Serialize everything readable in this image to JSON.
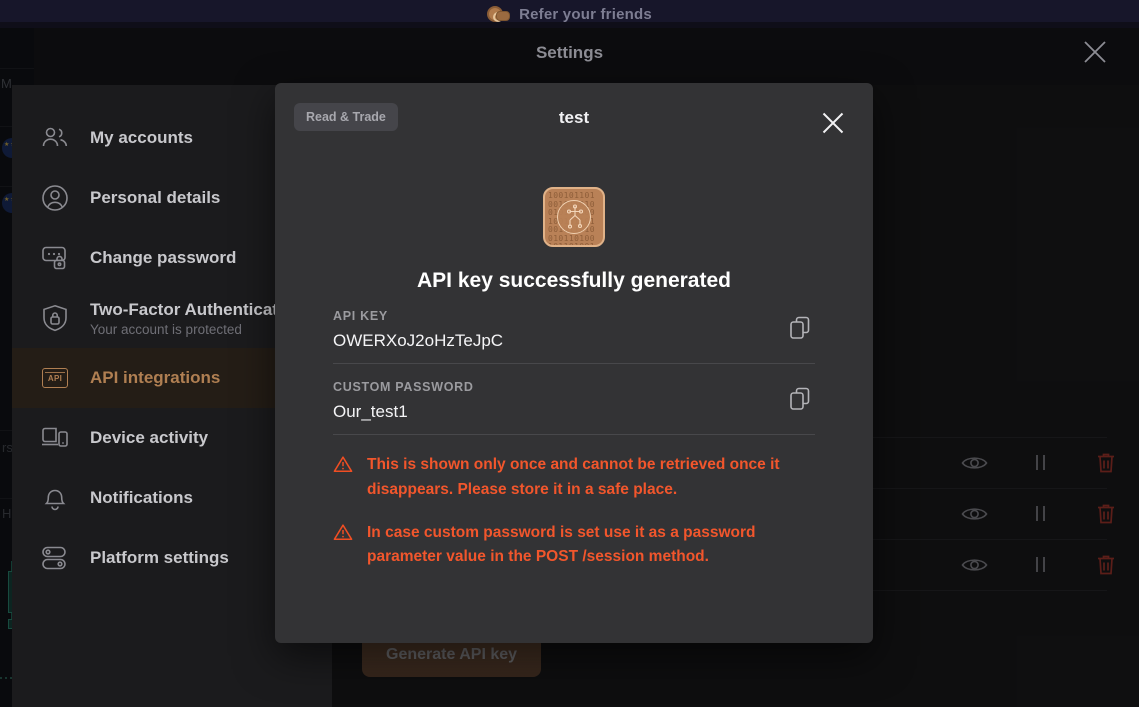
{
  "app": {
    "promo_banner": {
      "text": "Refer your friends",
      "coin_icon": "coins-icon"
    },
    "chart_strip": {
      "top_label": "M",
      "mid_label": "rs",
      "low_label": "H"
    }
  },
  "settings": {
    "title": "Settings",
    "close_icon": "close-icon",
    "sidebar": {
      "items": [
        {
          "label": "My accounts",
          "icon": "people-icon",
          "sub": "",
          "active": false
        },
        {
          "label": "Personal details",
          "icon": "user-circle-icon",
          "sub": "",
          "active": false
        },
        {
          "label": "Change password",
          "icon": "password-lock-icon",
          "sub": "",
          "active": false
        },
        {
          "label": "Two-Factor Authentication",
          "icon": "shield-lock-icon",
          "sub": "Your account is protected",
          "active": false
        },
        {
          "label": "API integrations",
          "icon": "api-icon",
          "sub": "",
          "active": true
        },
        {
          "label": "Device activity",
          "icon": "devices-icon",
          "sub": "",
          "active": false
        },
        {
          "label": "Notifications",
          "icon": "bell-icon",
          "sub": "",
          "active": false
        },
        {
          "label": "Platform settings",
          "icon": "toggles-icon",
          "sub": "",
          "active": false
        }
      ]
    }
  },
  "api_panel": {
    "generate_button": "Generate API key",
    "rows": [
      {
        "view_icon": "eye-icon",
        "pause_icon": "pause-icon",
        "delete_icon": "trash-icon"
      },
      {
        "view_icon": "eye-icon",
        "pause_icon": "pause-icon",
        "delete_icon": "trash-icon"
      },
      {
        "view_icon": "eye-icon",
        "pause_icon": "pause-icon",
        "delete_icon": "trash-icon"
      }
    ]
  },
  "modal": {
    "permission_pill": "Read & Trade",
    "title": "test",
    "close_icon": "close-icon",
    "hero_icon": "api-key-chip-icon",
    "hero_bits": "10010110100101101001011010010010110100101101001011010010110100101101001011010010110100101101001011010010110100101101001",
    "heading": "API key successfully generated",
    "fields": [
      {
        "label": "API KEY",
        "value": "OWERXoJ2oHzTeJpC",
        "copy_icon": "copy-icon"
      },
      {
        "label": "CUSTOM PASSWORD",
        "value": "Our_test1",
        "copy_icon": "copy-icon"
      }
    ],
    "warnings": [
      {
        "icon": "warning-triangle-icon",
        "text": "This is shown only once and cannot be retrieved once it disappears. Please store it in a safe place."
      },
      {
        "icon": "warning-triangle-icon",
        "text": "In case custom password is set use it as a password parameter value in the POST /session method."
      }
    ]
  },
  "colors": {
    "accent": "#b07f52",
    "warning": "#f2562c",
    "danger": "#c0392b",
    "modal_bg": "#333335",
    "sidebar_bg": "#1b1b1d"
  }
}
